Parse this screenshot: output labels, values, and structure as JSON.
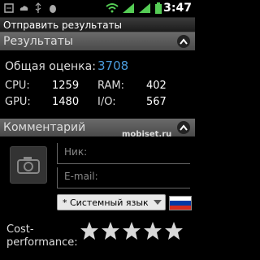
{
  "status_bar": {
    "time": "3:47"
  },
  "title": "Отправить результаты",
  "results": {
    "section_label": "Результаты",
    "overall_label": "Общая оценка:",
    "overall_value": "3708",
    "cpu_label": "CPU:",
    "cpu_value": "1259",
    "gpu_label": "GPU:",
    "gpu_value": "1480",
    "ram_label": "RAM:",
    "ram_value": "402",
    "io_label": "I/O:",
    "io_value": "567"
  },
  "comment": {
    "section_label": "Комментарий",
    "nick_placeholder": "Ник:",
    "email_placeholder": "E-mail:",
    "language_value": "* Системный язык",
    "cost_label": "Cost-\nperformance:",
    "stars_total": 5,
    "stars_filled": 0
  },
  "watermark": "mobiset.ru",
  "colors": {
    "accent": "#4a9bdc",
    "section_bg": "#5a5a5a"
  }
}
